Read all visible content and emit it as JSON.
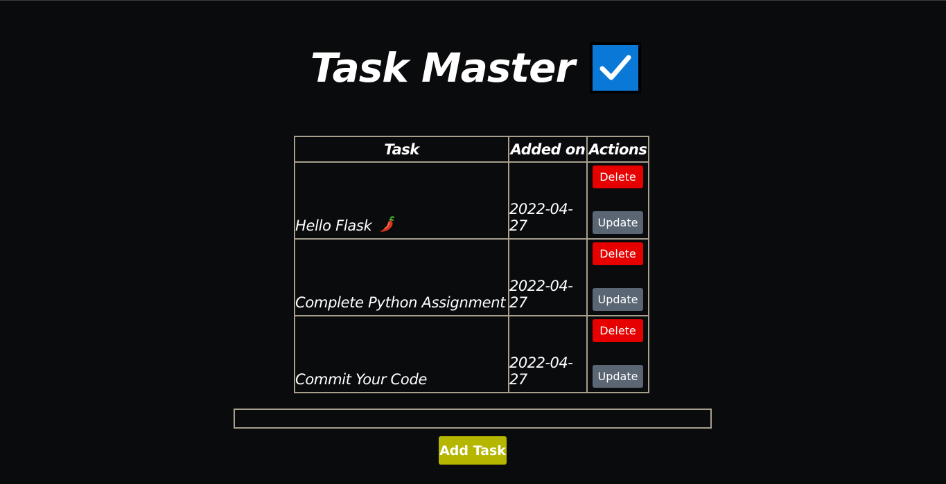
{
  "header": {
    "title": "Task Master",
    "title_icon": "checkbox-checked-icon",
    "icon_color": "#0a78d7"
  },
  "table": {
    "columns": [
      "Task",
      "Added on",
      "Actions"
    ],
    "rows": [
      {
        "task": "Hello Flask",
        "emoji_icon": "chili-pepper-icon",
        "date": "2022-04-27",
        "delete_label": "Delete",
        "update_label": "Update"
      },
      {
        "task": "Complete Python Assignment",
        "date": "2022-04-27",
        "delete_label": "Delete",
        "update_label": "Update"
      },
      {
        "task": "Commit Your Code",
        "date": "2022-04-27",
        "delete_label": "Delete",
        "update_label": "Update"
      }
    ]
  },
  "form": {
    "input_value": "",
    "input_placeholder": "",
    "add_label": "Add Task"
  },
  "colors": {
    "background": "#0a0b0d",
    "border": "#a89f8e",
    "delete": "#e60000",
    "update": "#5a6673",
    "add": "#b5b600"
  }
}
